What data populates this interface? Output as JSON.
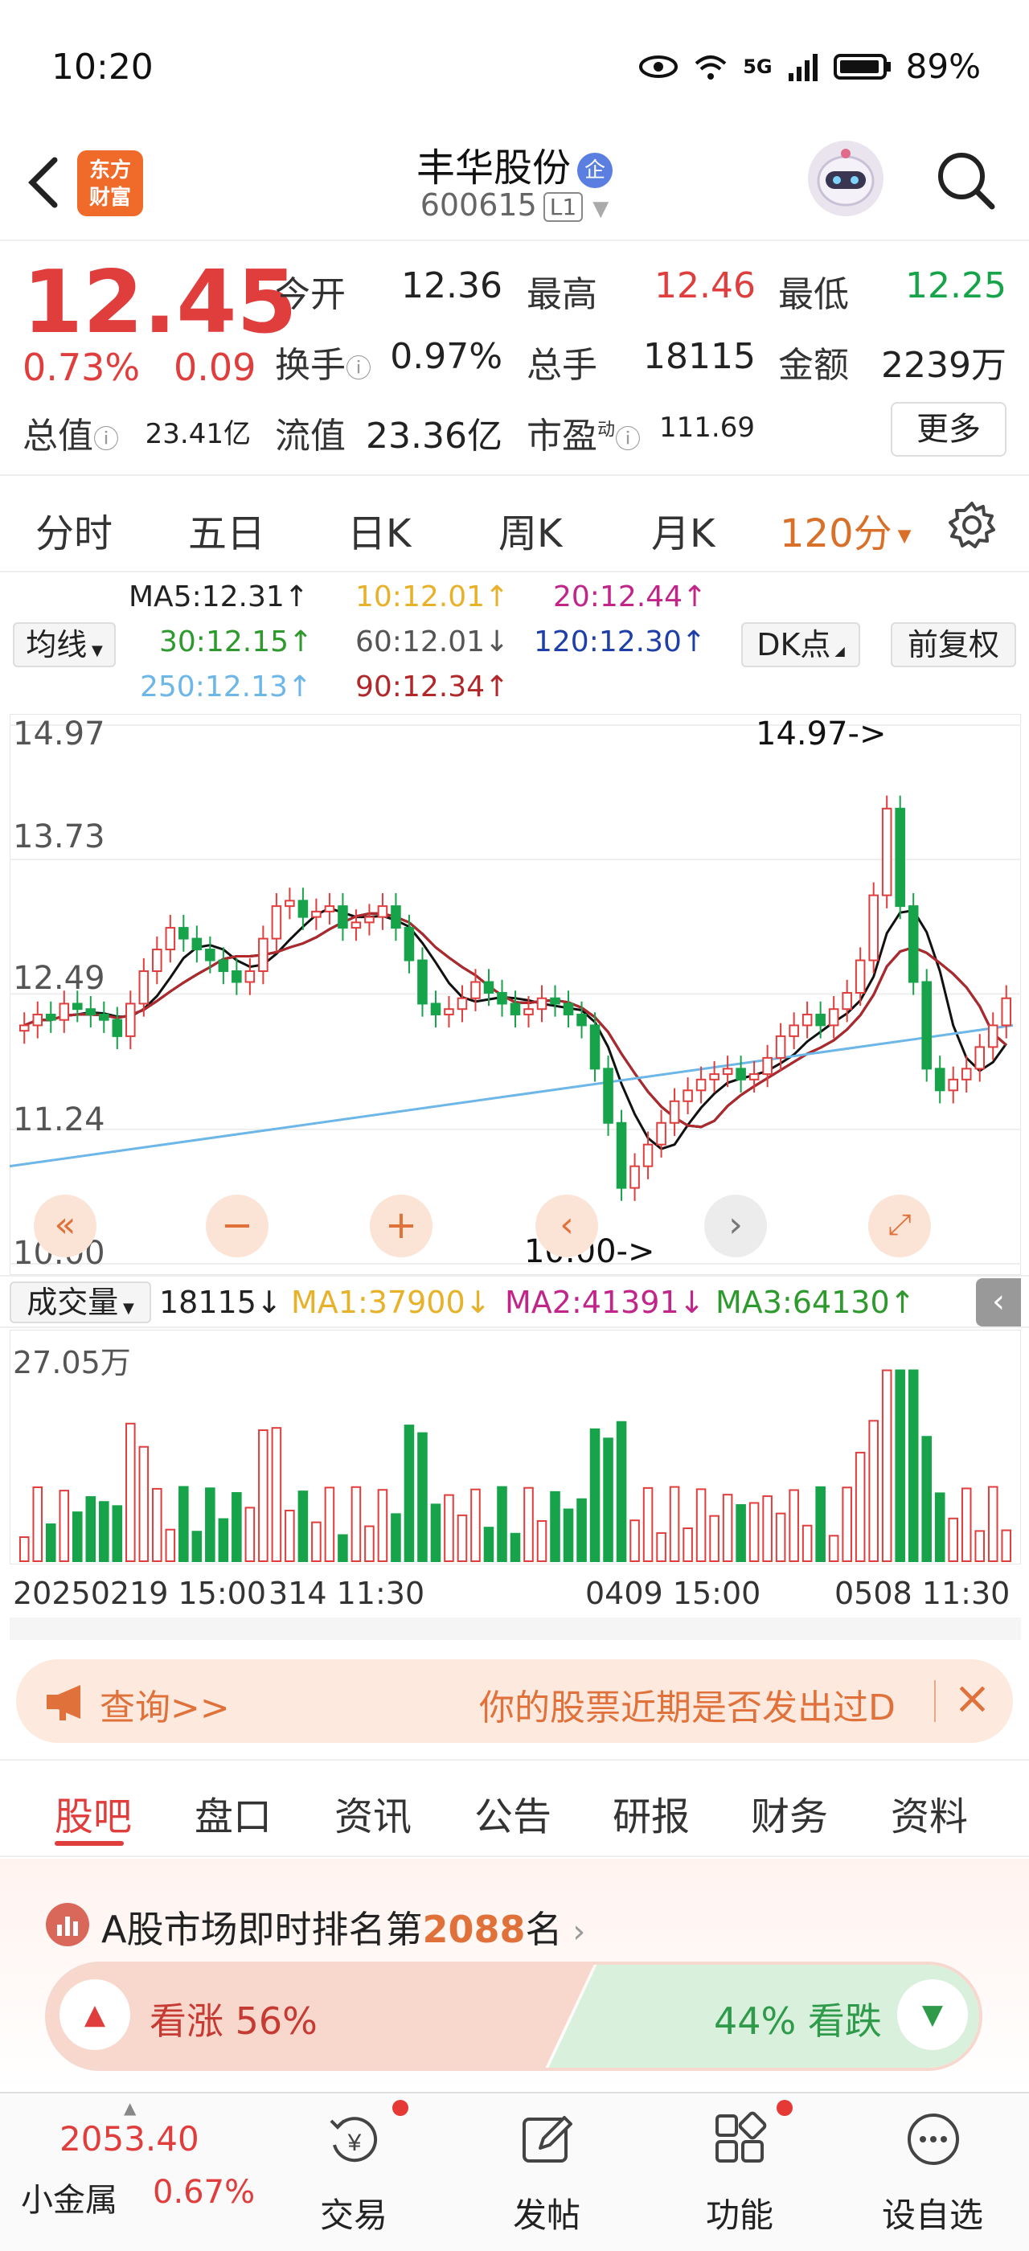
{
  "status_bar": {
    "time": "10:20",
    "battery": "89%",
    "network": "5G"
  },
  "header": {
    "app_logo_line1": "东方",
    "app_logo_line2": "财富",
    "stock_name": "丰华股份",
    "badge": "企",
    "code": "600615",
    "level": "L1"
  },
  "quote": {
    "price": "12.45",
    "change_pct": "0.73%",
    "change": "0.09",
    "open_label": "今开",
    "open": "12.36",
    "high_label": "最高",
    "high": "12.46",
    "low_label": "最低",
    "low": "12.25",
    "turnover_label": "换手",
    "turnover": "0.97%",
    "volume_label": "总手",
    "volume": "18115",
    "amount_label": "金额",
    "amount": "2239万",
    "total_value_label": "总值",
    "total_value": "23.41亿",
    "float_value_label": "流值",
    "float_value": "23.36亿",
    "pe_label": "市盈",
    "pe_sup": "动",
    "pe": "111.69",
    "more_label": "更多"
  },
  "kline_tabs": [
    {
      "label": "分时"
    },
    {
      "label": "五日"
    },
    {
      "label": "日K"
    },
    {
      "label": "周K"
    },
    {
      "label": "月K"
    },
    {
      "label": "120分"
    }
  ],
  "indicator": {
    "ma_select": "均线",
    "ma5": "MA5:12.31↑",
    "ma10": "10:12.01↑",
    "ma20": "20:12.44↑",
    "ma30": "30:12.15↑",
    "ma60": "60:12.01↓",
    "ma120": "120:12.30↑",
    "ma250": "250:12.13↑",
    "ma90": "90:12.34↑",
    "dk_label": "DK点",
    "fq_label": "前复权"
  },
  "chart_labels": {
    "y_ticks": [
      "14.97",
      "13.73",
      "12.49",
      "11.24",
      "10.00"
    ],
    "max_marker": "14.97->",
    "min_marker": "10.00->"
  },
  "volume": {
    "select": "成交量",
    "value": "18115↓",
    "ma1": "MA1:37900↓",
    "ma2": "MA2:41391↓",
    "ma3": "MA3:64130↑",
    "y_max": "27.05万"
  },
  "x_axis": {
    "l1": "20250219 15:00",
    "l2": "314 11:30",
    "l3": "0409 15:00",
    "l4": "0508 11:30"
  },
  "banner": {
    "left": "查询>>",
    "right": "你的股票近期是否发出过D"
  },
  "bottom_tabs": [
    {
      "label": "股吧"
    },
    {
      "label": "盘口"
    },
    {
      "label": "资讯"
    },
    {
      "label": "公告"
    },
    {
      "label": "研报"
    },
    {
      "label": "财务"
    },
    {
      "label": "资料"
    }
  ],
  "rank": {
    "prefix": "A股市场即时排名第",
    "rank": "2088",
    "suffix": "名"
  },
  "vote": {
    "up_label": "看涨 56%",
    "down_label": "44% 看跌",
    "up_fraction": 0.56
  },
  "nav": {
    "index_value": "2053.40",
    "index_name": "小金属",
    "index_change": "0.67%",
    "items": [
      {
        "label": "交易"
      },
      {
        "label": "发帖"
      },
      {
        "label": "功能"
      },
      {
        "label": "设自选"
      }
    ]
  },
  "colors": {
    "up": "#e03d3d",
    "down": "#16a34a",
    "accent": "#d8702a"
  },
  "chart_data": {
    "type": "candlestick",
    "ylim": [
      10.0,
      14.97
    ],
    "y_ticks": [
      14.97,
      13.73,
      12.49,
      11.24,
      10.0
    ],
    "close": [
      12.2,
      12.3,
      12.25,
      12.4,
      12.35,
      12.3,
      12.25,
      12.1,
      12.4,
      12.7,
      12.9,
      13.1,
      13.0,
      12.9,
      12.8,
      12.7,
      12.6,
      12.7,
      13.0,
      13.3,
      13.35,
      13.2,
      13.25,
      13.3,
      13.1,
      13.15,
      13.2,
      13.3,
      13.1,
      12.8,
      12.4,
      12.3,
      12.35,
      12.45,
      12.6,
      12.5,
      12.4,
      12.3,
      12.35,
      12.45,
      12.4,
      12.3,
      12.2,
      11.8,
      11.3,
      10.7,
      10.9,
      11.1,
      11.3,
      11.5,
      11.6,
      11.7,
      11.75,
      11.8,
      11.7,
      11.75,
      11.9,
      12.1,
      12.2,
      12.3,
      12.2,
      12.35,
      12.5,
      12.8,
      13.4,
      14.2,
      13.3,
      12.6,
      11.8,
      11.6,
      11.7,
      11.8,
      12.0,
      12.2,
      12.45
    ],
    "volume_max_label": "27.05万"
  }
}
